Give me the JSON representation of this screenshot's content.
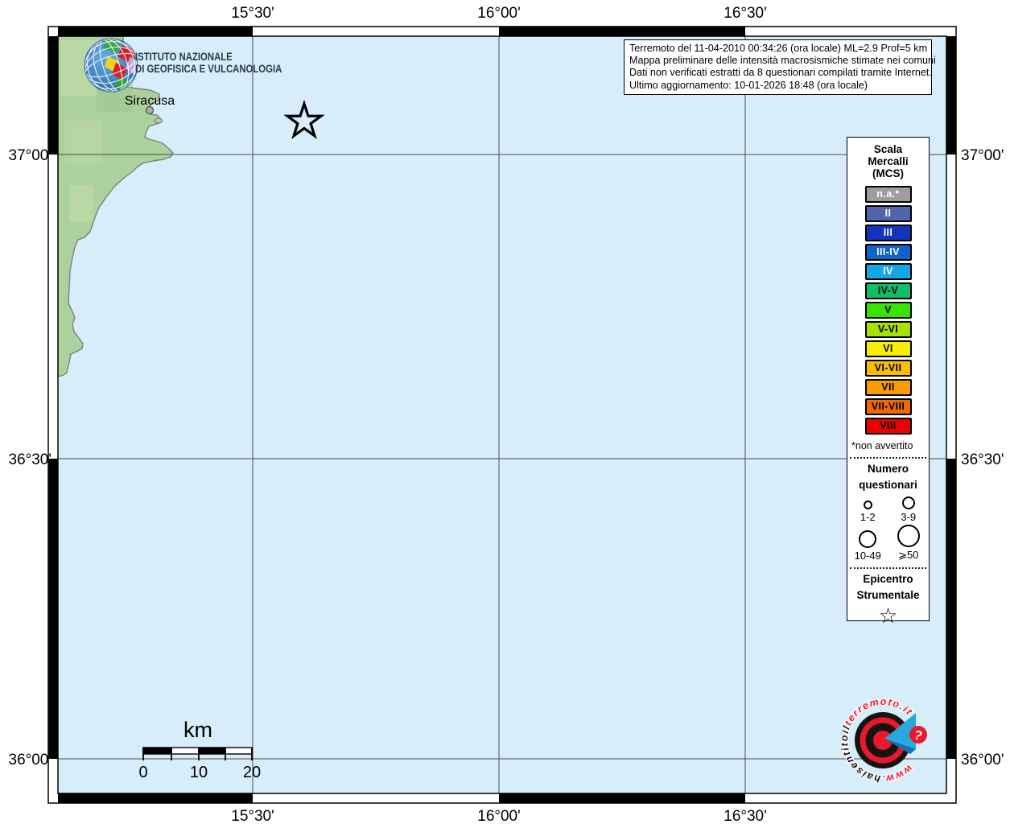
{
  "info_box": {
    "line1": "Terremoto del 11-04-2010 00:34:26 (ora locale) ML=2.9 Prof=5 km",
    "line2": "Mappa preliminare delle intensità macrosismiche stimate nei comuni",
    "line3": "Dati non verificati estratti da 8 questionari compilati tramite Internet.",
    "line4": "Ultimo aggiornamento: 10-01-2026 18:48 (ora locale)"
  },
  "header": {
    "ingv_line1": "ISTITUTO NAZIONALE",
    "ingv_line2": "DI GEOFISICA E VULCANOLOGIA"
  },
  "map": {
    "city": "Siracusa",
    "sea_color": "#d7edf9",
    "land_color": "#abd19c",
    "axis": {
      "top": [
        "15°30'",
        "16°00'",
        "16°30'"
      ],
      "bottom": [
        "15°30'",
        "16°00'",
        "16°30'"
      ],
      "left": [
        "37°00'",
        "36°30'",
        "36°00'"
      ],
      "right": [
        "37°00'",
        "36°30'",
        "36°00'"
      ]
    }
  },
  "scale_bar": {
    "unit": "km",
    "ticks": [
      "0",
      "10",
      "20"
    ]
  },
  "legend": {
    "title_line1": "Scala",
    "title_line2": "Mercalli",
    "title_line3": "(MCS)",
    "intensity_levels": [
      {
        "label": "n.a.*",
        "color": "#9e9e9e",
        "text": "#ffffff"
      },
      {
        "label": "II",
        "color": "#5065ab",
        "text": "#ffffff"
      },
      {
        "label": "III",
        "color": "#1134b8",
        "text": "#ffffff"
      },
      {
        "label": "III-IV",
        "color": "#0d64cc",
        "text": "#ffffff"
      },
      {
        "label": "IV",
        "color": "#16a6e6",
        "text": "#ffffff"
      },
      {
        "label": "IV-V",
        "color": "#0fbf68",
        "text": "#000000"
      },
      {
        "label": "V",
        "color": "#36e600",
        "text": "#000000"
      },
      {
        "label": "V-VI",
        "color": "#a8e000",
        "text": "#000000"
      },
      {
        "label": "VI",
        "color": "#f8ef00",
        "text": "#000000"
      },
      {
        "label": "VI-VII",
        "color": "#fbbd00",
        "text": "#000000"
      },
      {
        "label": "VII",
        "color": "#f89c00",
        "text": "#000000"
      },
      {
        "label": "VII-VIII",
        "color": "#f06800",
        "text": "#000000"
      },
      {
        "label": "VIII",
        "color": "#ea0000",
        "text": "#000000"
      }
    ],
    "footnote": "*non avvertito",
    "questionnaires": {
      "title_line1": "Numero",
      "title_line2": "questionari",
      "classes": [
        {
          "label": "1-2"
        },
        {
          "label": "3-9"
        },
        {
          "label": "10-49"
        },
        {
          "label": "⩾50"
        }
      ]
    },
    "epicenter": {
      "title_line1": "Epicentro",
      "title_line2": "Strumentale",
      "symbol": "☆"
    }
  },
  "watermark": {
    "www": "www.",
    "middle": "haisentitoil",
    "domain": "terremoto.it",
    "question_mark": "?",
    "red": "#e8192c",
    "blue": "#29a8e0"
  }
}
